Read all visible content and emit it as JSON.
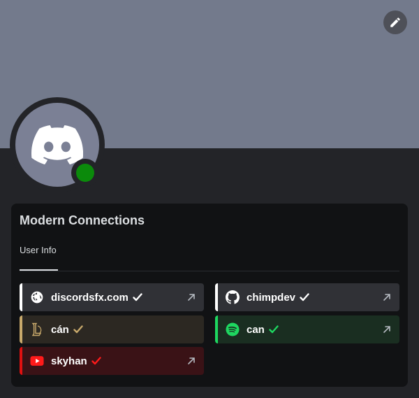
{
  "panel": {
    "title": "Modern Connections",
    "tab_label": "User Info"
  },
  "colors": {
    "banner": "#737a8c",
    "status_online": "#0b8a0b"
  },
  "connections": [
    {
      "name": "discordsfx.com",
      "icon": "globe-icon",
      "check_color": "#ffffff",
      "bg": "#303136",
      "accent": "#ffffff"
    },
    {
      "name": "chimpdev",
      "icon": "github-icon",
      "check_color": "#ffffff",
      "bg": "#303136",
      "accent": "#ffffff"
    },
    {
      "name": "cán",
      "icon": "league-of-legends-icon",
      "check_color": "#c8a96b",
      "bg": "#2c2822",
      "accent": "#c8a96b"
    },
    {
      "name": "can",
      "icon": "spotify-icon",
      "check_color": "#1ed760",
      "bg": "#1a2e21",
      "accent": "#1ed760"
    },
    {
      "name": "skyhan",
      "icon": "youtube-icon",
      "check_color": "#ff1a1a",
      "bg": "#3a1216",
      "accent": "#e01010"
    }
  ]
}
